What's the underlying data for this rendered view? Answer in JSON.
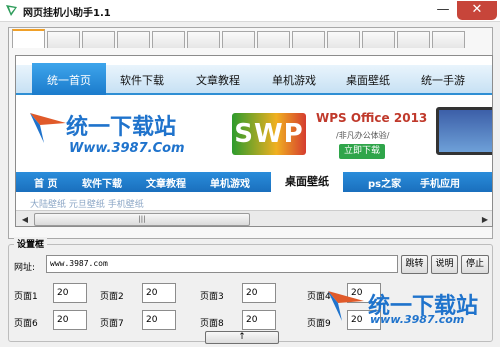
{
  "window": {
    "title": "网页挂机小助手1.1",
    "minimize_glyph": "—",
    "close_glyph": "✕"
  },
  "tabs": {
    "count": 13,
    "active_index": 0
  },
  "browser": {
    "top_nav": [
      "统一首页",
      "软件下载",
      "文章教程",
      "单机游戏",
      "桌面壁纸",
      "统一手游"
    ],
    "logo": {
      "name": "统一下载站",
      "url": "Www.3987.Com"
    },
    "ad": {
      "mark": "SWP",
      "title": "WPS Office 2013",
      "subtitle": "/非凡办公体验/",
      "button": "立即下载"
    },
    "sub_nav": [
      "首 页",
      "软件下载",
      "文章教程",
      "单机游戏",
      "桌面壁纸",
      "ps之家",
      "手机应用"
    ],
    "third_nav": "大陆壁纸    元旦壁纸    手机壁纸",
    "scroll": {
      "left_arrow": "◀",
      "right_arrow": "▶",
      "thumb": "|||"
    }
  },
  "settings": {
    "group_label": "设置框",
    "url_label": "网址:",
    "url_value": "www.3987.com",
    "buttons": {
      "go": "跳转",
      "help": "说明",
      "stop": "停止"
    },
    "pages": [
      {
        "label": "页面1",
        "value": "20"
      },
      {
        "label": "页面2",
        "value": "20"
      },
      {
        "label": "页面3",
        "value": "20"
      },
      {
        "label": "页面4",
        "value": "20"
      },
      {
        "label": "页面6",
        "value": "20"
      },
      {
        "label": "页面7",
        "value": "20"
      },
      {
        "label": "页面8",
        "value": "20"
      },
      {
        "label": "页面9",
        "value": "20"
      }
    ],
    "toggle_glyph": "↑"
  },
  "watermark": {
    "name": "统一下载站",
    "url": "www.3987.com"
  },
  "colors": {
    "accent_blue": "#1f73cc",
    "nav_blue": "#2a8ddb",
    "tab_active": "#f0a028",
    "close_red": "#c7453a"
  }
}
